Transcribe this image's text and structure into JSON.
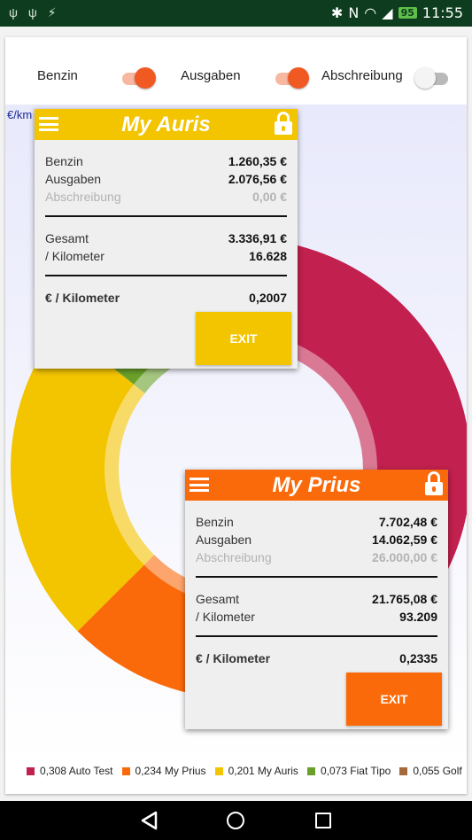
{
  "status_bar": {
    "left_icons": "ψ ψ ⚡",
    "battery": "95",
    "time": "11:55"
  },
  "toggles": [
    {
      "label": "Benzin",
      "on": true
    },
    {
      "label": "Ausgaben",
      "on": true
    },
    {
      "label": "Abschreibung",
      "on": false
    }
  ],
  "chart": {
    "unit_label": "€/km"
  },
  "chart_data": {
    "type": "pie",
    "style": "donut",
    "categories": [
      "Auto Test",
      "My Prius",
      "My Auris",
      "Fiat Tipo",
      "Golf"
    ],
    "values": [
      0.308,
      0.234,
      0.201,
      0.073,
      0.055
    ],
    "colors": [
      "#c2204e",
      "#fb6a0a",
      "#f3c400",
      "#6aa02a",
      "#a56a3c"
    ],
    "legend_position": "bottom"
  },
  "legend": [
    {
      "value": "0,308",
      "name": "Auto Test",
      "color": "#c2204e"
    },
    {
      "value": "0,234",
      "name": "My Prius",
      "color": "#fb6a0a"
    },
    {
      "value": "0,201",
      "name": "My Auris",
      "color": "#f3c400"
    },
    {
      "value": "0,073",
      "name": "Fiat Tipo",
      "color": "#6aa02a"
    },
    {
      "value": "0,055",
      "name": "Golf",
      "color": "#a56a3c"
    }
  ],
  "popup_auris": {
    "title": "My Auris",
    "color": "#f3c400",
    "benzin_label": "Benzin",
    "benzin_value": "1.260,35 €",
    "ausgaben_label": "Ausgaben",
    "ausgaben_value": "2.076,56 €",
    "abschreibung_label": "Abschreibung",
    "abschreibung_value": "0,00 €",
    "gesamt_label": "Gesamt",
    "gesamt_value": "3.336,91 €",
    "km_label": "/ Kilometer",
    "km_value": "16.628",
    "per_km_label": "€ / Kilometer",
    "per_km_value": "0,2007",
    "exit_label": "EXIT"
  },
  "popup_prius": {
    "title": "My Prius",
    "color": "#fb6a0a",
    "benzin_label": "Benzin",
    "benzin_value": "7.702,48 €",
    "ausgaben_label": "Ausgaben",
    "ausgaben_value": "14.062,59 €",
    "abschreibung_label": "Abschreibung",
    "abschreibung_value": "26.000,00 €",
    "gesamt_label": "Gesamt",
    "gesamt_value": "21.765,08 €",
    "km_label": "/ Kilometer",
    "km_value": "93.209",
    "per_km_label": "€ / Kilometer",
    "per_km_value": "0,2335",
    "exit_label": "EXIT"
  }
}
